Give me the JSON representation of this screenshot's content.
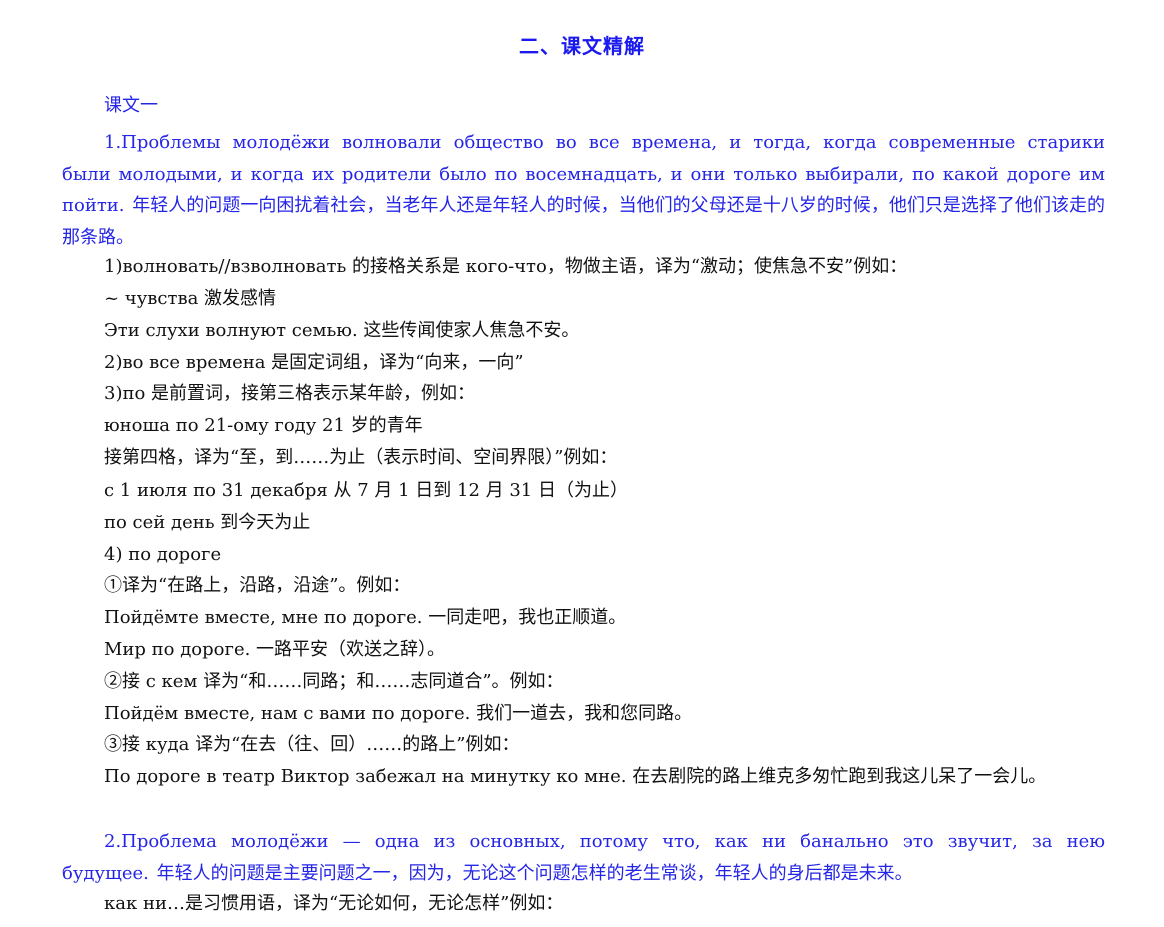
{
  "heading": "二、课文精解",
  "section_label": "课文一",
  "para1": "1.Проблемы молодёжи волновали общество во все времена, и тогда, когда современные старики были молодыми, и когда их родители было по восемнадцать, и они только выбирали, по какой дороге им пойти. 年轻人的问题一向困扰着社会，当老年人还是年轻人的时候，当他们的父母还是十八岁的时候，他们只是选择了他们该走的那条路。",
  "notes": [
    "1)волновать//взволновать 的接格关系是 кого-что，物做主语，译为“激动；使焦急不安”例如：",
    "~ чувства 激发感情",
    "Эти слухи волнуют семью.  这些传闻使家人焦急不安。",
    "2)во все времена 是固定词组，译为“向来，一向”",
    "3)по 是前置词，接第三格表示某年龄，例如：",
    "юноша по 21-ому году 21 岁的青年",
    "接第四格，译为“至，到……为止（表示时间、空间界限）”例如：",
    "с 1 июля по 31 декабря  从 7 月 1 日到 12 月 31 日（为止）",
    "по сей день  到今天为止",
    "4) по дороге",
    "①译为“在路上，沿路，沿途”。例如：",
    "Пойдёмте  вместе, мне по дороге.  一同走吧，我也正顺道。",
    "Мир по дороге.  一路平安（欢送之辞）。",
    "②接 с кем 译为“和……同路；和……志同道合”。例如：",
    "Пойдём  вместе, нам с вами по дороге.  我们一道去，我和您同路。",
    "③接 куда 译为“在去（往、回）……的路上”例如：",
    "По  дороге в театр  Виктор  забежал  на минутку  ко мне.  在去剧院的路上维克多匆忙跑到我这儿呆了一会儿。"
  ],
  "para2": "2.Проблема молодёжи — одна из основных, потому что, как ни банально это звучит, за нею будущее.  年轻人的问题是主要问题之一，因为，无论这个问题怎样的老生常谈，年轻人的身后都是未来。",
  "note_last": "как ни…是习惯用语，译为“无论如何，无论怎样”例如：",
  "colors": {
    "heading": "#1a1aee",
    "body_blue": "#2525e6",
    "text": "#111111"
  }
}
